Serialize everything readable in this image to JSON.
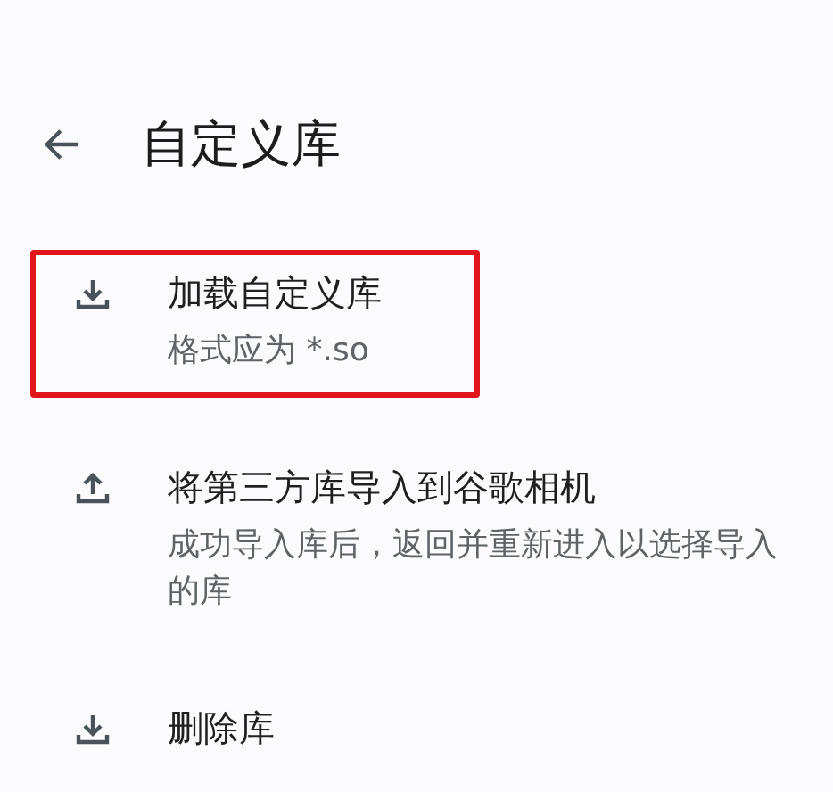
{
  "header": {
    "title": "自定义库"
  },
  "items": [
    {
      "kind": "download",
      "title": "加载自定义库",
      "description": "格式应为 *.so",
      "highlighted": true
    },
    {
      "kind": "upload",
      "title": "将第三方库导入到谷歌相机",
      "description": "成功导入库后，返回并重新进入以选择导入的库",
      "highlighted": false
    },
    {
      "kind": "download",
      "title": "删除库",
      "highlighted": false
    }
  ]
}
